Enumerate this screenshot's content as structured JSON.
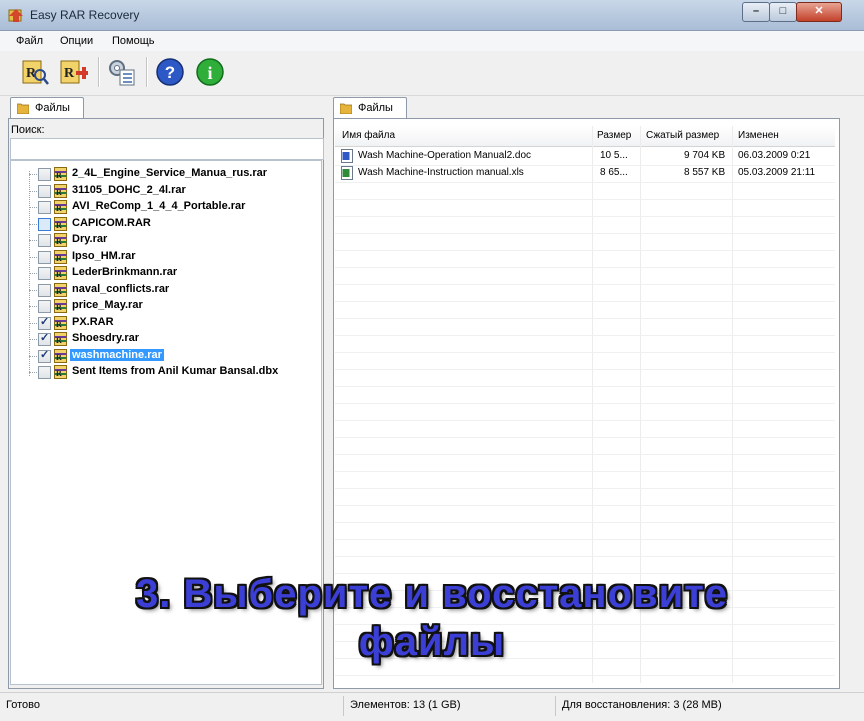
{
  "window": {
    "title": "Easy RAR Recovery",
    "min_label": "–",
    "max_label": "□",
    "close_label": "✕"
  },
  "menu": {
    "items": [
      "Файл",
      "Опции",
      "Помощь"
    ]
  },
  "toolbar": {
    "icons": [
      "rar-search-icon",
      "rar-repair-icon",
      "settings-list-icon",
      "help-icon",
      "info-icon"
    ]
  },
  "left_panel": {
    "tab_label": "Файлы",
    "search_label": "Поиск:",
    "search_value": "",
    "files": [
      {
        "name": "2_4L_Engine_Service_Manua_rus.rar",
        "checked": false
      },
      {
        "name": "31105_DOHC_2_4l.rar",
        "checked": false
      },
      {
        "name": "AVI_ReComp_1_4_4_Portable.rar",
        "checked": false
      },
      {
        "name": "CAPICOM.RAR",
        "checked": false
      },
      {
        "name": "Dry.rar",
        "checked": false
      },
      {
        "name": "Ipso_HM.rar",
        "checked": false
      },
      {
        "name": "LederBrinkmann.rar",
        "checked": false
      },
      {
        "name": "naval_conflicts.rar",
        "checked": false
      },
      {
        "name": "price_May.rar",
        "checked": false
      },
      {
        "name": "PX.RAR",
        "checked": true
      },
      {
        "name": "Shoesdry.rar",
        "checked": true
      },
      {
        "name": "washmachine.rar",
        "checked": true,
        "selected": true
      },
      {
        "name": "Sent Items from Anil Kumar Bansal.dbx",
        "checked": false
      }
    ]
  },
  "right_panel": {
    "tab_label": "Файлы",
    "columns": [
      "Имя файла",
      "Размер",
      "Сжатый размер",
      "Изменен"
    ],
    "rows": [
      {
        "icon": "doc-file-icon",
        "name": "Wash Machine-Operation Manual2.doc",
        "size": "10 5...",
        "packed": "9 704 KB",
        "modified": "06.03.2009 0:21"
      },
      {
        "icon": "xls-file-icon",
        "name": "Wash Machine-Instruction manual.xls",
        "size": "8 65...",
        "packed": "8 557 KB",
        "modified": "05.03.2009 21:11"
      }
    ]
  },
  "status": {
    "ready": "Готово",
    "elements": "Элементов: 13 (1 GB)",
    "recover": "Для восстановления: 3 (28 MB)"
  },
  "caption": {
    "line1": "3. Выберите и восстановите",
    "line2": "файлы"
  }
}
